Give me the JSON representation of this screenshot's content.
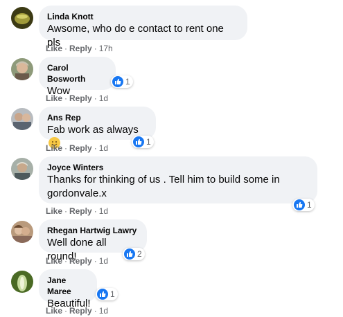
{
  "comments": [
    {
      "name": "Linda Knott",
      "text": "Awsome, who do e contact to rent one pls",
      "like": "Like",
      "reply": "Reply",
      "time": "17h",
      "avatar_color": "#6b6a2c",
      "avatar_icon": "avatar-photo"
    },
    {
      "name": "Carol Bosworth",
      "text": "Wow",
      "like": "Like",
      "reply": "Reply",
      "time": "1d",
      "reactions": "1",
      "avatar_color": "#a58c6c",
      "avatar_icon": "avatar-photo"
    },
    {
      "name": "Ans Rep",
      "text": "Fab work as always",
      "emoji": "smiling-face-emoji",
      "like": "Like",
      "reply": "Reply",
      "time": "1d",
      "reactions": "1",
      "avatar_color": "#8a8f96",
      "avatar_icon": "avatar-photo"
    },
    {
      "name": "Joyce Winters",
      "text_line1": "Thanks for thinking of us . Tell him to build some in",
      "text_line2": "gordonvale.x",
      "like": "Like",
      "reply": "Reply",
      "time": "1d",
      "reactions": "1",
      "avatar_color": "#7f8a8c",
      "avatar_icon": "avatar-photo"
    },
    {
      "name": "Rhegan Hartwig Lawry",
      "text": "Well done all round!",
      "like": "Like",
      "reply": "Reply",
      "time": "1d",
      "reactions": "2",
      "avatar_color": "#9a7d66",
      "avatar_icon": "avatar-photo"
    },
    {
      "name": "Jane Maree",
      "text": "Beautiful!",
      "like": "Like",
      "reply": "Reply",
      "time": "1d",
      "reactions": "1",
      "avatar_color": "#6d8a3e",
      "avatar_icon": "avatar-photo"
    }
  ],
  "colors": {
    "bubble": "#f0f2f5",
    "name_text": "#050505",
    "meta_text": "#65676b",
    "like_blue": "#1877f2"
  }
}
